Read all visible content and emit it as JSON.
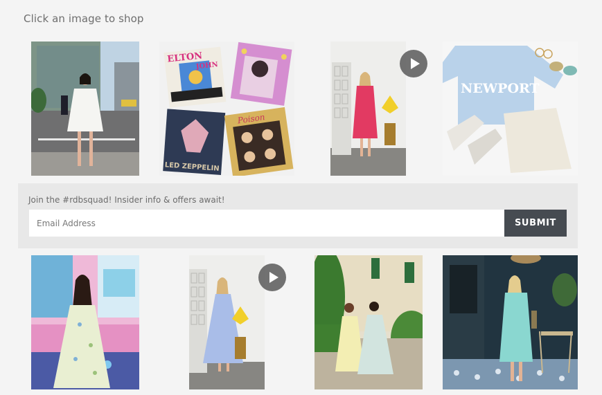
{
  "heading": "Click an image to shop",
  "newsletter": {
    "text": "Join the #rdbsquad! Insider info & offers await!",
    "email_placeholder": "Email Address",
    "submit_label": "SUBMIT"
  },
  "album_art": {
    "elton": "ELTON JOHN",
    "zeppelin": "LED ZEPPELIN",
    "poison": "Poison"
  },
  "sweater_text": "NEWPORT"
}
